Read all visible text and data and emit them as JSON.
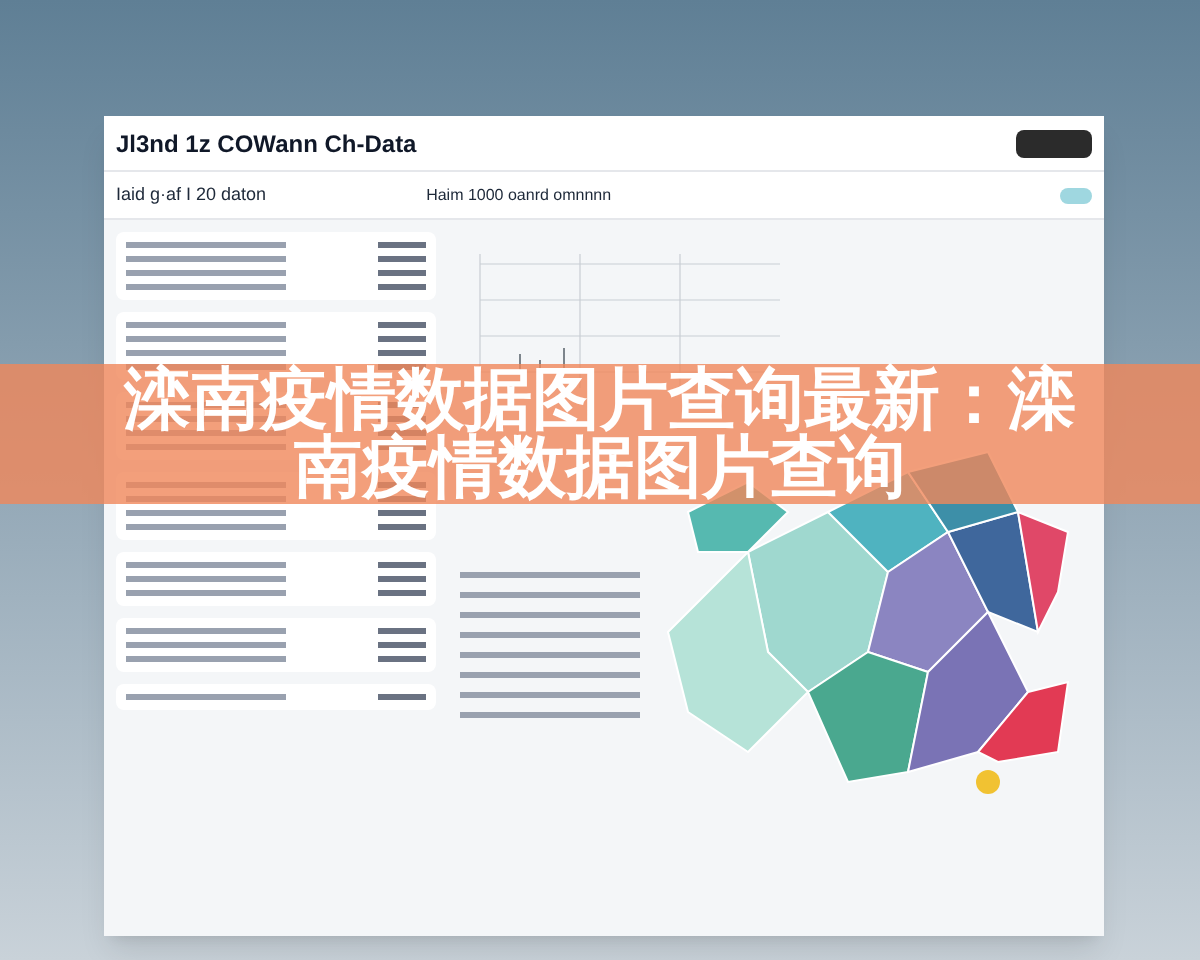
{
  "header": {
    "title": "Jl3nd 1z COWann Ch-Data"
  },
  "toolbar": {
    "left_label": "Iaid g·af I 20 daton",
    "center_label": "Haim 1000 oanrd omnnnn"
  },
  "banner": {
    "lines": [
      "滦南疫情数据图片查询最新：滦",
      "南疫情数据图片查询"
    ]
  }
}
